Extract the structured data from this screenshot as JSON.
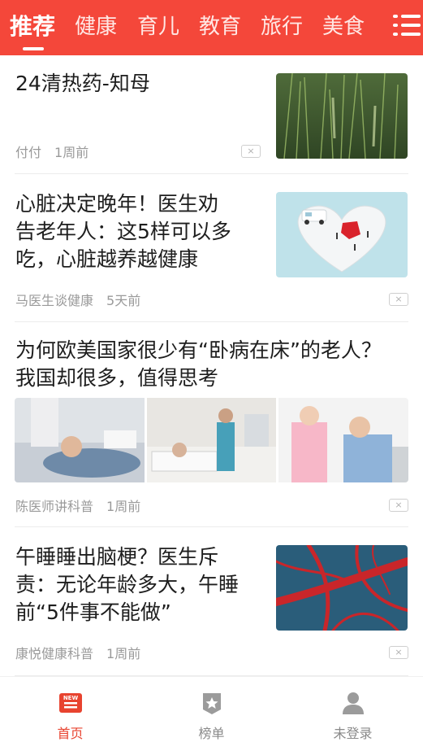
{
  "tabs": [
    {
      "label": "推荐"
    },
    {
      "label": "健康"
    },
    {
      "label": "育儿"
    },
    {
      "label": "教育"
    },
    {
      "label": "旅行"
    },
    {
      "label": "美食"
    }
  ],
  "active_tab": "推荐",
  "menu_icon": "menu-icon",
  "colors": {
    "header": "#f4473a",
    "nav_active": "#e8432f",
    "meta": "#9a9a9a"
  },
  "articles": [
    {
      "title": "24清热药-知母",
      "author": "付付",
      "time": "1周前",
      "dismiss": "×"
    },
    {
      "title_line1": "心脏决定晚年！医生劝",
      "title_line2": "告老年人：这5样可以多",
      "title_line3": "吃，心脏越养越健康",
      "author": "马医生谈健康",
      "time": "5天前",
      "dismiss": "×"
    },
    {
      "title_line1": "为何欧美国家很少有“卧病在床”的老人？",
      "title_line2": "我国却很多，值得思考",
      "author": "陈医师讲科普",
      "time": "1周前",
      "dismiss": "×"
    },
    {
      "title_line1": "午睡睡出脑梗？医生斥",
      "title_line2": "责：无论年龄多大，午睡",
      "title_line3": "前“5件事不能做”",
      "author": "康悦健康科普",
      "time": "1周前",
      "dismiss": "×"
    }
  ],
  "bottom_nav": [
    {
      "label": "首页",
      "icon": "news-icon",
      "active": true
    },
    {
      "label": "榜单",
      "icon": "star-badge-icon",
      "active": false
    },
    {
      "label": "未登录",
      "icon": "user-icon",
      "active": false
    }
  ]
}
